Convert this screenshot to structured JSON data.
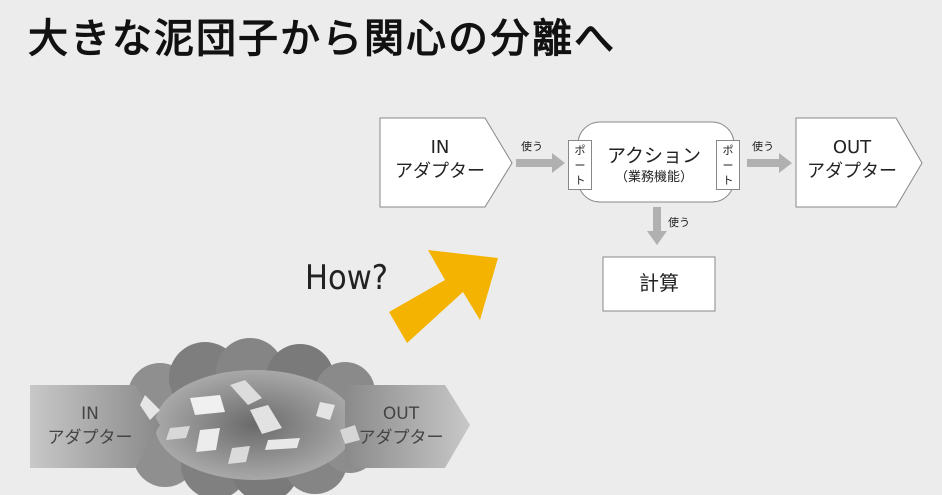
{
  "title": "大きな泥団子から関心の分離へ",
  "diagram": {
    "in_adapter": {
      "line1": "IN",
      "line2": "アダプター"
    },
    "out_adapter": {
      "line1": "OUT",
      "line2": "アダプター"
    },
    "action": {
      "label": "アクション",
      "sublabel": "（業務機能）"
    },
    "port_left": {
      "ch1": "ポ",
      "ch2": "ー",
      "ch3": "ト"
    },
    "port_right": {
      "ch1": "ポ",
      "ch2": "ー",
      "ch3": "ト"
    },
    "uses_label_1": "使う",
    "uses_label_2": "使う",
    "uses_label_3": "使う",
    "calc": "計算",
    "how": "How?"
  },
  "mudball": {
    "in_adapter": {
      "line1": "IN",
      "line2": "アダプター"
    },
    "out_adapter": {
      "line1": "OUT",
      "line2": "アダプター"
    }
  },
  "colors": {
    "background": "#ececec",
    "arrow_accent": "#f5b301",
    "connector": "#b0b0b0"
  }
}
